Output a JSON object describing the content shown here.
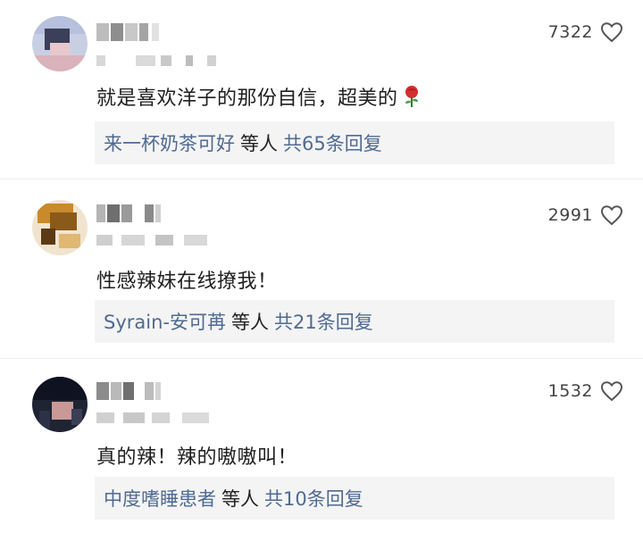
{
  "comments": [
    {
      "likes": "7322",
      "text": "就是喜欢洋子的那份自信，超美的",
      "reply_user": "来一杯奶茶可好",
      "reply_mid": "等人",
      "reply_count": "共65条回复"
    },
    {
      "likes": "2991",
      "text": "性感辣妹在线撩我！",
      "reply_user": "Syrain-安可苒",
      "reply_mid": "等人",
      "reply_count": "共21条回复"
    },
    {
      "likes": "1532",
      "text": "真的辣！辣的嗷嗷叫！",
      "reply_user": "中度嗜睡患者",
      "reply_mid": "等人",
      "reply_count": "共10条回复"
    }
  ],
  "icons": {
    "like": "heart-outline-icon",
    "emoji": "rose-emoji-icon"
  },
  "colors": {
    "link": "#4f6a92",
    "text": "#1e1e1e",
    "reply_bg": "#f4f4f4"
  }
}
